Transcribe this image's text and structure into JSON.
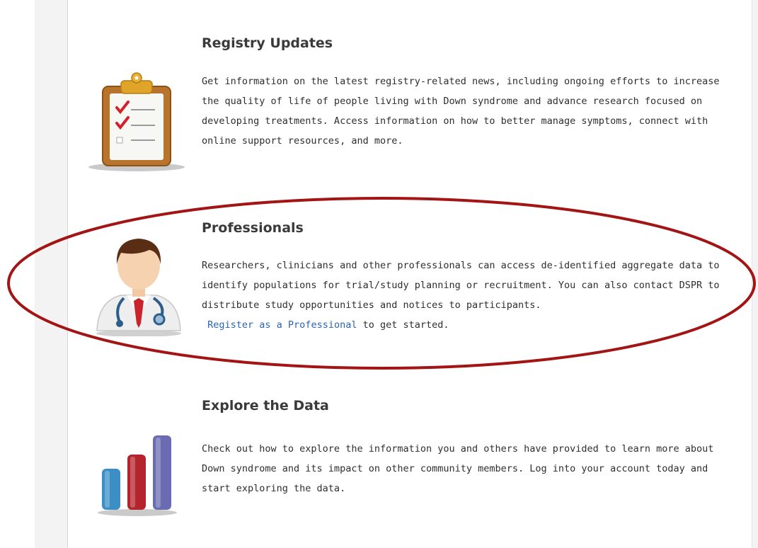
{
  "sections": [
    {
      "title": "Registry Updates",
      "description": "Get information on the latest registry-related news, including ongoing efforts to increase the quality of life of people living with Down syndrome and advance research focused on developing treatments. Access information on how to better manage symptoms, connect with online support resources, and more.",
      "icon": "clipboard-checklist-icon"
    },
    {
      "title": "Professionals",
      "description": "Researchers, clinicians and other professionals can access de-identified aggregate data to identify populations for trial/study planning or recruitment. You can also contact DSPR to distribute study opportunities and notices to participants.",
      "link_text": "Register as a Professional",
      "link_suffix": " to get started.",
      "icon": "doctor-avatar-icon"
    },
    {
      "title": "Explore the Data",
      "description": "Check out how to explore the information you and others have provided to learn more about Down syndrome and its impact on other community members. Log into your account today and start exploring the data.",
      "icon": "bar-chart-icon"
    }
  ],
  "colors": {
    "highlight_oval": "#a31515",
    "link": "#2a64b8",
    "bar_blue": "#3b8fc4",
    "bar_red": "#b3242c",
    "bar_purple": "#6a6bb0"
  }
}
